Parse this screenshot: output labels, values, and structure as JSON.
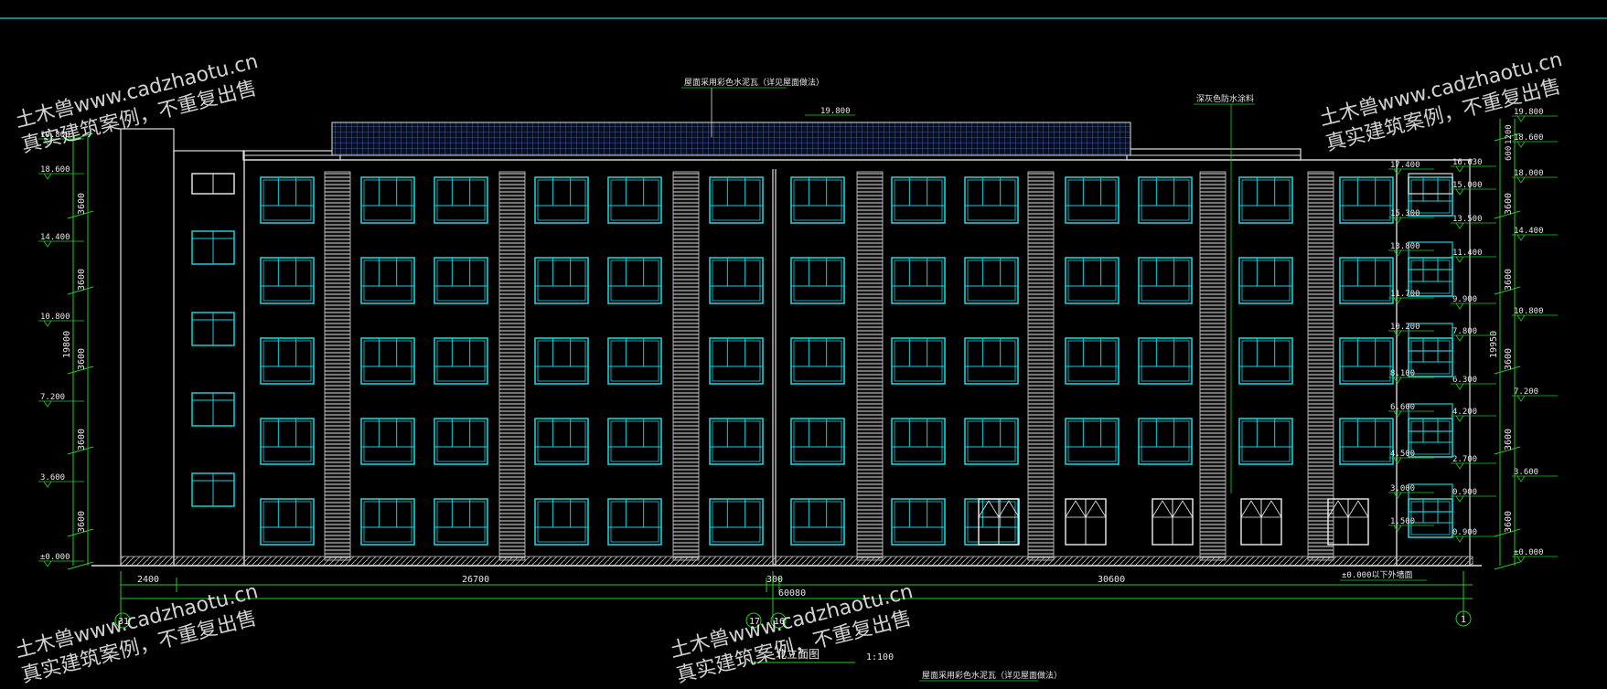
{
  "drawing": {
    "title": "北立面图",
    "scale": "1:100",
    "axis_left": "31",
    "axis_mid_a": "17",
    "axis_mid_b": "16",
    "axis_right": "1",
    "total_length": "60080",
    "segments": [
      "2400",
      "26700",
      "300",
      "30600"
    ],
    "left_floor_dims": [
      "3600",
      "3600",
      "3600",
      "3600",
      "3600"
    ],
    "left_total": "19800",
    "right_floor_dims": [
      "3600",
      "3600",
      "3600",
      "3600",
      "3600"
    ],
    "right_total": "19950",
    "roof_top_left": "19.800",
    "roof_mid_right": "1200",
    "top_dim_right": "600",
    "note_top_center": "屋面采用彩色水泥瓦（详见屋面做法）",
    "note_top_right": "深灰色防水涂料",
    "note_ground_right": "±0.000以下外墙面",
    "note_bottom_center": "屋面采用彩色水泥瓦（详见屋面做法）",
    "roof_label": "19.800"
  },
  "elevations_left": [
    "19.800",
    "18.600",
    "14.400",
    "10.800",
    "7.200",
    "3.600",
    "±0.000"
  ],
  "elevations_inner": [
    "17.400",
    "15.300",
    "13.800",
    "11.700",
    "10.200",
    "8.100",
    "6.600",
    "4.500",
    "3.000",
    "1.500"
  ],
  "elevations_inner_right": [
    "16.630",
    "15.000",
    "13.500",
    "11.400",
    "9.900",
    "7.800",
    "6.300",
    "4.200",
    "2.700",
    "0.900",
    "0.900"
  ],
  "elevations_right": [
    "19.800",
    "18.600",
    "18.000",
    "14.400",
    "10.800",
    "7.200",
    "3.600",
    "±0.000"
  ],
  "watermark": {
    "line1": "土木兽www.cadzhaotu.cn",
    "line2": "真实建筑案例，不重复出售"
  },
  "colors": {
    "window": "#19d0d8",
    "dimension": "#22cc22",
    "outline": "#e0e0e0",
    "frame": "#2aa7ad"
  }
}
